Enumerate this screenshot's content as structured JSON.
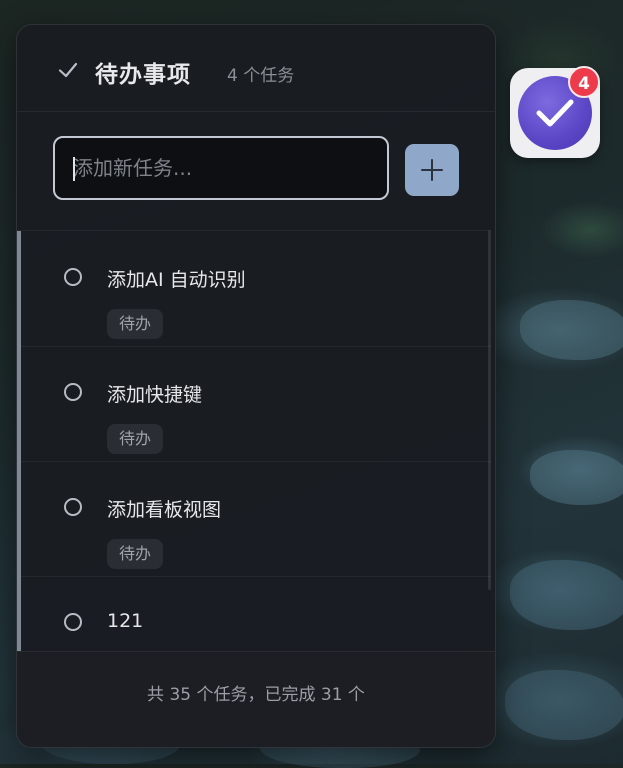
{
  "header": {
    "title": "待办事项",
    "count_text": "4 个任务",
    "icon": "check-icon"
  },
  "new_task": {
    "placeholder": "添加新任务...",
    "value": "",
    "add_icon": "plus-icon"
  },
  "tasks": [
    {
      "title": "添加AI 自动识别",
      "tag": "待办",
      "completed": false
    },
    {
      "title": "添加快捷键",
      "tag": "待办",
      "completed": false
    },
    {
      "title": "添加看板视图",
      "tag": "待办",
      "completed": false
    },
    {
      "title": "121",
      "tag": "",
      "completed": false
    }
  ],
  "footer": {
    "summary": "共 35 个任务，已完成 31 个"
  },
  "dock_app": {
    "icon": "todo-app-check-icon",
    "badge": "4"
  },
  "colors": {
    "panel_bg": "#191c21",
    "accent_button": "#8fa8c9",
    "badge_red": "#ee3b4b",
    "app_purple": "#5b47c6"
  }
}
